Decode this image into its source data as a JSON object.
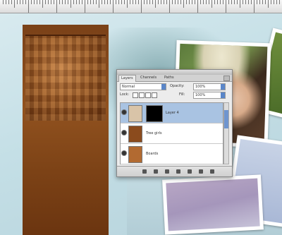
{
  "ui": {
    "panel_tabs": [
      "Layers",
      "Channels",
      "Paths"
    ],
    "blend_mode_label": "Normal",
    "opacity_label": "Opacity:",
    "opacity_value": "100%",
    "lock_label": "Lock:",
    "fill_label": "Fill:",
    "fill_value": "100%",
    "layers": [
      {
        "name": "Layer 4",
        "selected": true,
        "thumb_color": "#d9c4a8",
        "has_mask": true
      },
      {
        "name": "Tree girls",
        "selected": false,
        "thumb_color": "#8b4b1d",
        "has_mask": false
      },
      {
        "name": "Boards",
        "selected": false,
        "thumb_color": "#b26a31",
        "has_mask": false
      }
    ],
    "bottom_icons": [
      "link-icon",
      "fx-icon",
      "mask-icon",
      "adjustment-icon",
      "group-icon",
      "new-layer-icon",
      "trash-icon"
    ]
  },
  "colors": {
    "accent": "#5a86c9",
    "selected_row": "#a9c3e2",
    "sepia": "#8b4b1d"
  }
}
